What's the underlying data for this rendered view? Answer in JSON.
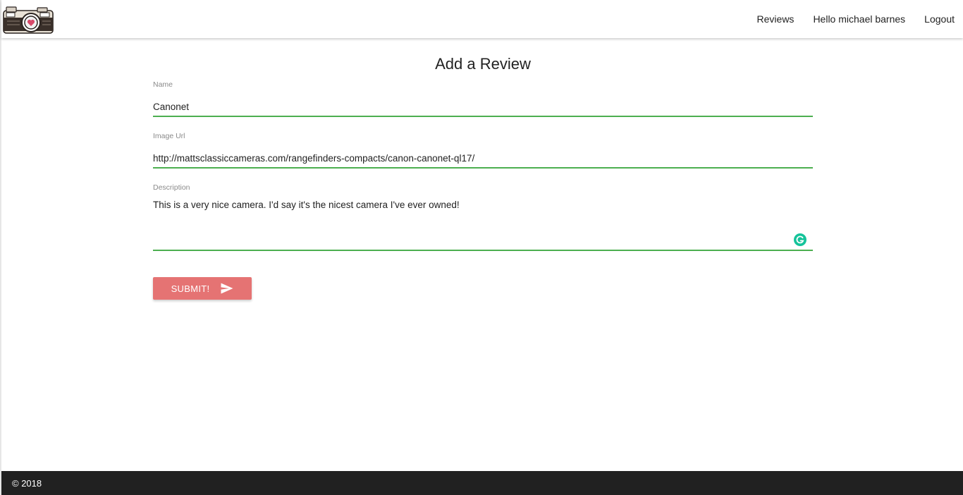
{
  "header": {
    "logo_icon": "camera-logo-icon",
    "nav": {
      "reviews": "Reviews",
      "greeting": "Hello michael barnes",
      "logout": "Logout"
    }
  },
  "form": {
    "title": "Add a Review",
    "name": {
      "label": "Name",
      "value": "Canonet"
    },
    "image_url": {
      "label": "Image Url",
      "value": "http://mattsclassiccameras.com/rangefinders-compacts/canon-canonet-ql17/"
    },
    "description": {
      "label": "Description",
      "value": "This is a very nice camera. I'd say it's the nicest camera I've ever owned!"
    },
    "submit_label": "SUBMIT!",
    "submit_icon": "send-icon"
  },
  "footer": {
    "copyright": "© 2018"
  },
  "colors": {
    "accent_underline": "#4caf50",
    "submit_button": "#e57373",
    "footer_bg": "#212121",
    "grammarly": "#15c39a"
  }
}
